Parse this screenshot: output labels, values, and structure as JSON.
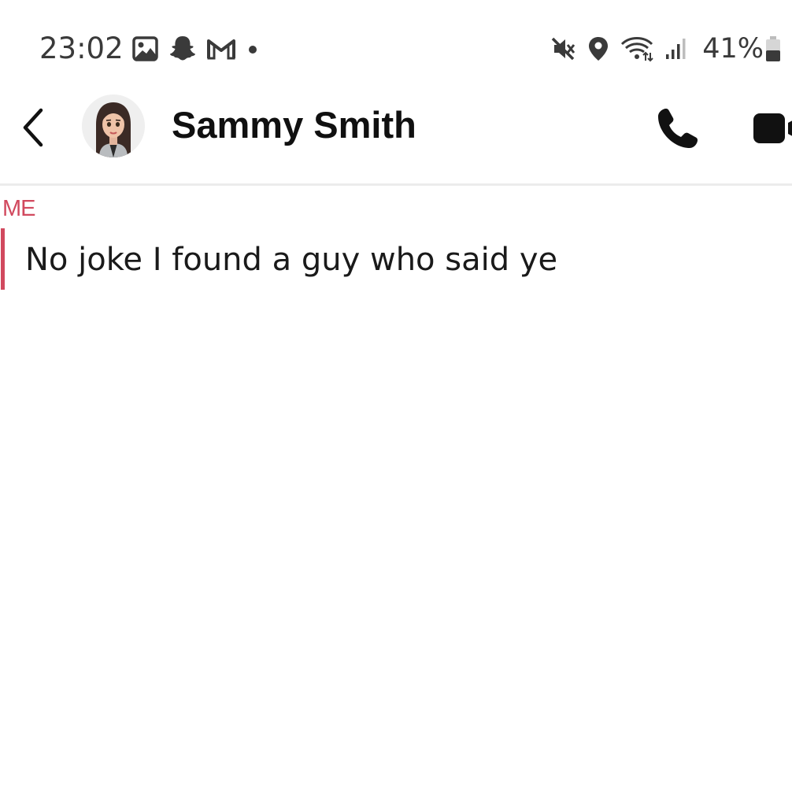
{
  "status_bar": {
    "time": "23:02",
    "left_icons": [
      "gallery-icon",
      "snapchat-ghost-icon",
      "gmail-icon",
      "notification-dot-icon"
    ],
    "right_icons": [
      "mute-icon",
      "location-icon",
      "wifi-icon",
      "signal-icon",
      "battery-icon"
    ],
    "battery_percent": "41%"
  },
  "header": {
    "contact_name": "Sammy Smith",
    "back_icon": "chevron-left-icon",
    "call_icon": "phone-icon",
    "video_icon": "video-camera-icon"
  },
  "chat": {
    "messages": [
      {
        "sender": "ME",
        "text": "No joke I found a guy who said ye"
      }
    ]
  },
  "colors": {
    "me_accent": "#d1495e",
    "text_primary": "#101010",
    "divider": "#ececec"
  }
}
